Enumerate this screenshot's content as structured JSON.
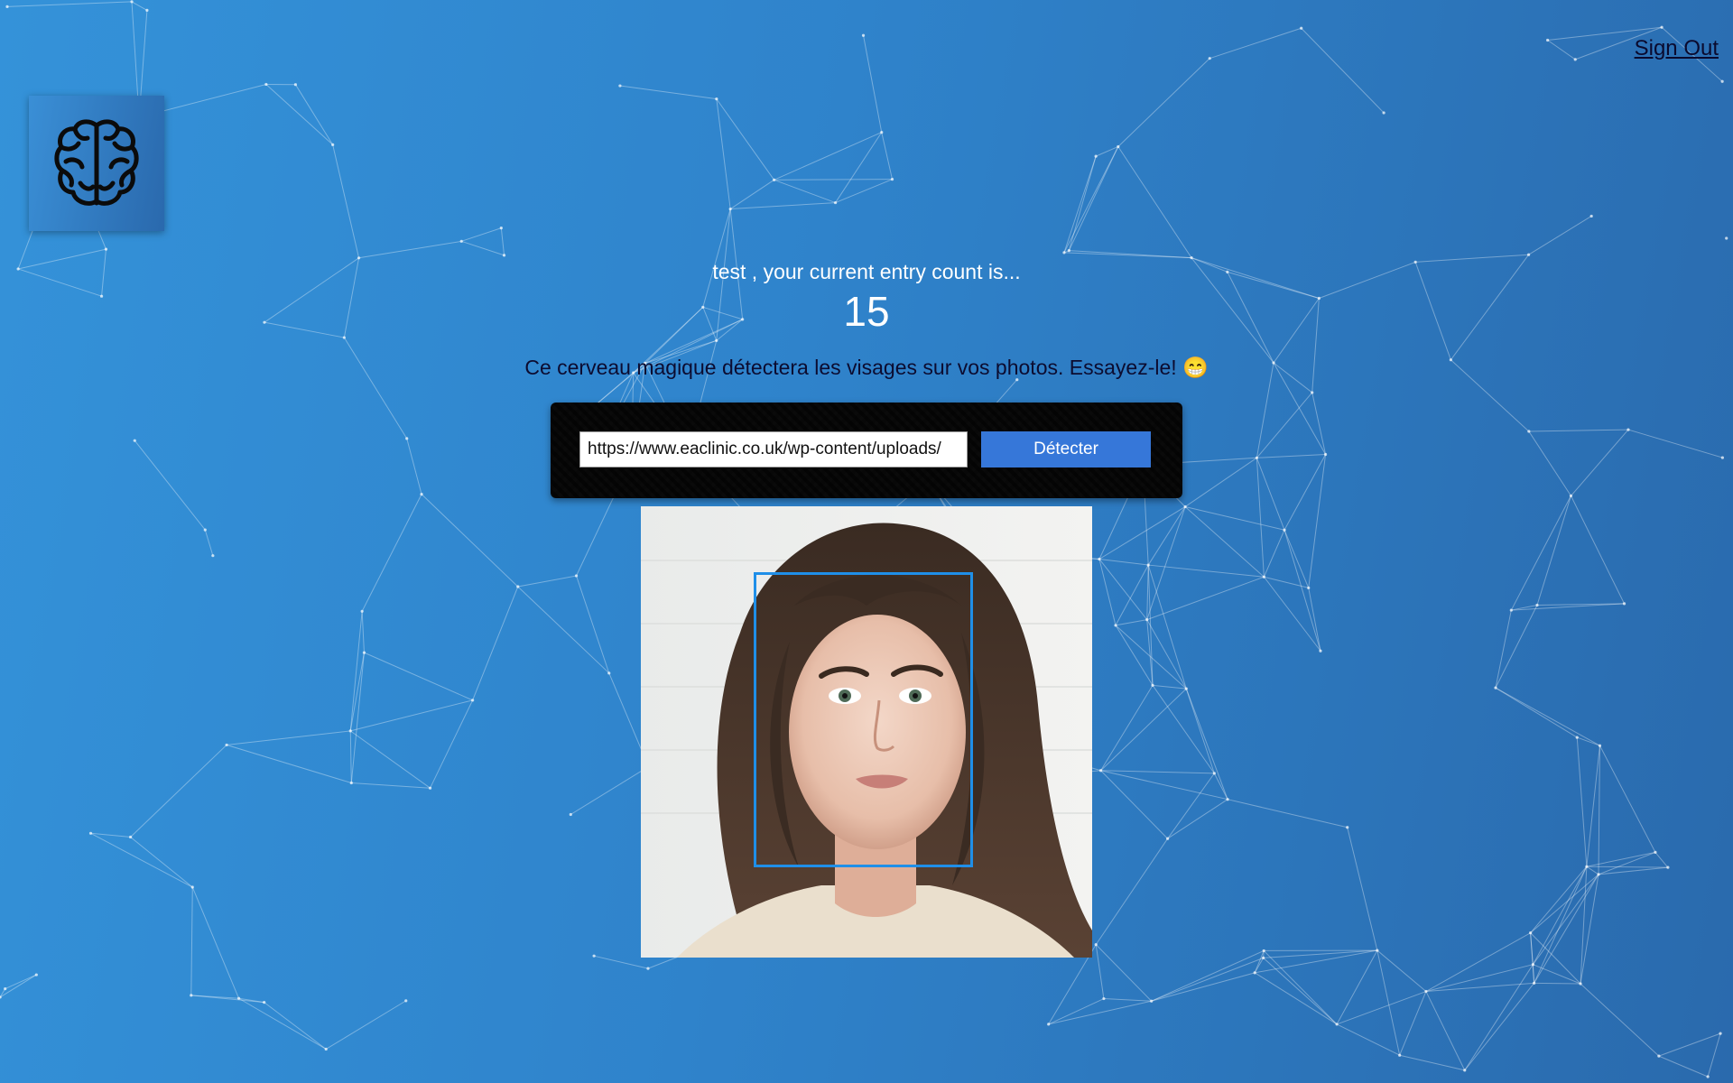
{
  "header": {
    "sign_out_label": "Sign Out"
  },
  "logo": {
    "icon": "brain-icon"
  },
  "rank": {
    "greeting": "test , your current entry count is...",
    "count": "15"
  },
  "tagline": "Ce cerveau magique détectera les visages sur vos photos. Essayez-le! 😁",
  "form": {
    "url_value": "https://www.eaclinic.co.uk/wp-content/uploads/",
    "detect_label": "Détecter"
  },
  "colors": {
    "background_start": "#3492d9",
    "background_end": "#2a6aad",
    "button": "#3677d9",
    "face_box_border": "#1f8fe8"
  }
}
